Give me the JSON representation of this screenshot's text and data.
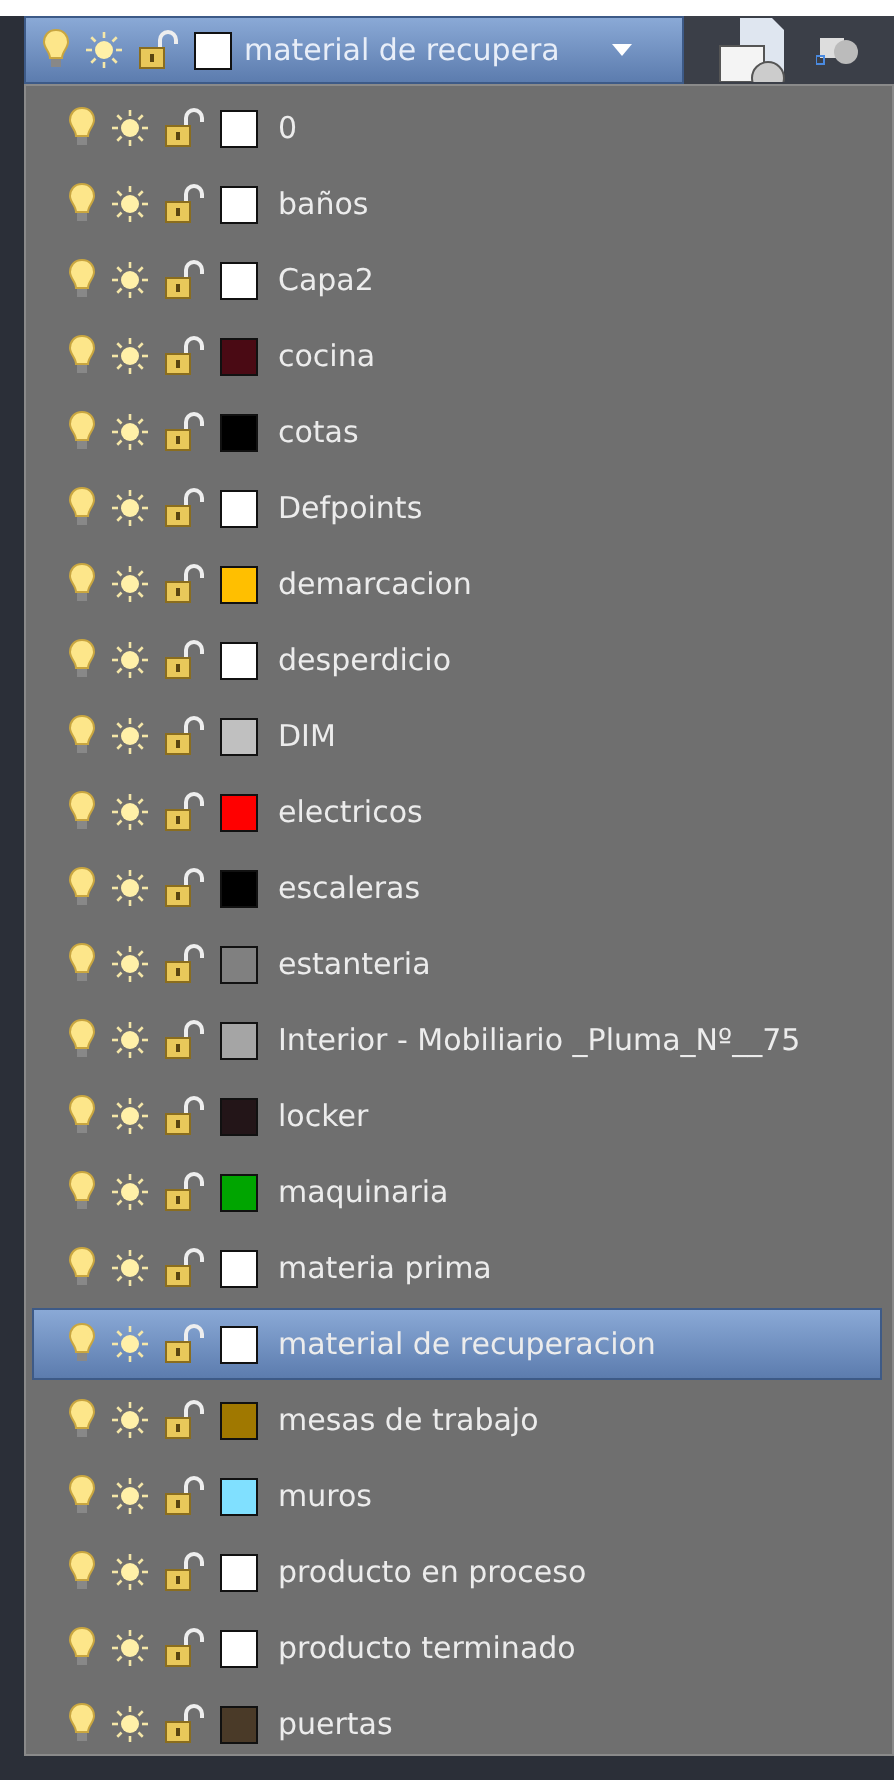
{
  "current_layer": {
    "name": "material de recupera",
    "color": "#ffffff"
  },
  "layers": [
    {
      "name": "0",
      "color": "#ffffff",
      "selected": false
    },
    {
      "name": "baños",
      "color": "#ffffff",
      "selected": false
    },
    {
      "name": "Capa2",
      "color": "#ffffff",
      "selected": false
    },
    {
      "name": "cocina",
      "color": "#4a0a14",
      "selected": false
    },
    {
      "name": "cotas",
      "color": "#000000",
      "selected": false
    },
    {
      "name": "Defpoints",
      "color": "#ffffff",
      "selected": false
    },
    {
      "name": "demarcacion",
      "color": "#ffbf00",
      "selected": false
    },
    {
      "name": "desperdicio",
      "color": "#ffffff",
      "selected": false
    },
    {
      "name": "DIM",
      "color": "#c0c0c0",
      "selected": false
    },
    {
      "name": "electricos",
      "color": "#ff0000",
      "selected": false
    },
    {
      "name": "escaleras",
      "color": "#000000",
      "selected": false
    },
    {
      "name": "estanteria",
      "color": "#808080",
      "selected": false
    },
    {
      "name": "Interior - Mobiliario _Pluma_Nº__75",
      "color": "#a5a5a5",
      "selected": false
    },
    {
      "name": "locker",
      "color": "#231518",
      "selected": false
    },
    {
      "name": "maquinaria",
      "color": "#00a500",
      "selected": false
    },
    {
      "name": "materia prima",
      "color": "#ffffff",
      "selected": false
    },
    {
      "name": "material de recuperacion",
      "color": "#ffffff",
      "selected": true
    },
    {
      "name": "mesas de trabajo",
      "color": "#a07800",
      "selected": false
    },
    {
      "name": "muros",
      "color": "#80e0ff",
      "selected": false
    },
    {
      "name": "producto en proceso",
      "color": "#ffffff",
      "selected": false
    },
    {
      "name": "producto terminado",
      "color": "#ffffff",
      "selected": false
    },
    {
      "name": "puertas",
      "color": "#4a3a28",
      "selected": false
    }
  ]
}
